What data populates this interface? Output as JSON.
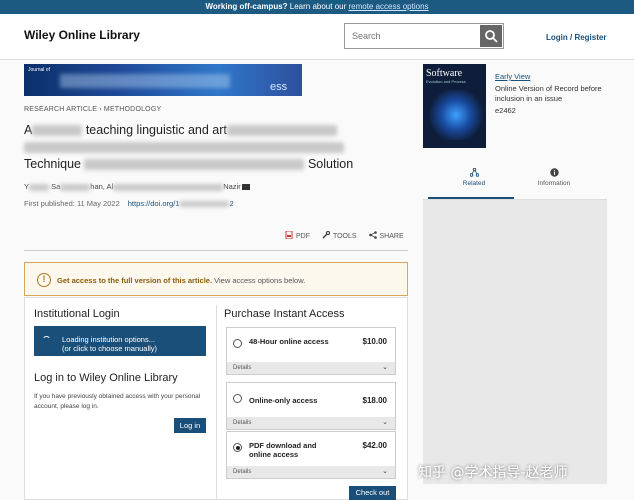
{
  "topbar": {
    "bold": "Working off-campus?",
    "text": " Learn about our ",
    "link": "remote access options"
  },
  "header": {
    "logo": "Wiley Online Library",
    "search_placeholder": "Search",
    "login": "Login / Register"
  },
  "journal": {
    "banner_small": "Journal of",
    "banner_visible": "ess"
  },
  "article": {
    "kind": "RESEARCH ARTICLE › METHODOLOGY",
    "title_line1_start": "A",
    "title_line1_mid": " teaching linguistic and art",
    "title_line3_start": "Technique",
    "title_line3_end": "Solution",
    "authors_start": "Y",
    "authors_mid1": " Sa",
    "authors_mid2": "han, Al",
    "authors_end": "Nazir",
    "published_label": "First published: 11 May 2022",
    "doi": "https://doi.org/1",
    "doi_end": "2"
  },
  "tools": {
    "pdf": "PDF",
    "tools": "TOOLS",
    "share": "SHARE"
  },
  "notice": {
    "bold": "Get access to the full version of this article.",
    "text": " View access options below."
  },
  "institutional": {
    "title": "Institutional Login",
    "button_line1": "Loading institution options...",
    "button_line2": "(or click to choose manually)"
  },
  "wol": {
    "title": "Log in to Wiley Online Library",
    "text": "If you have previously obtained access with your personal account, please log in.",
    "button": "Log in"
  },
  "purchase": {
    "title": "Purchase Instant Access",
    "options": [
      {
        "label": "48-Hour online access",
        "price": "$10.00",
        "details": "Details",
        "selected": false
      },
      {
        "label": "Online-only access",
        "price": "$18.00",
        "details": "Details",
        "selected": false
      },
      {
        "label": "PDF download and online access",
        "price": "$42.00",
        "details": "Details",
        "selected": true
      }
    ],
    "checkout": "Check out"
  },
  "sidebar": {
    "cover_title": "Software",
    "cover_sub": "Evolution and Process",
    "early_view": "Early View",
    "early_desc": "Online Version of Record before inclusion in an issue",
    "article_id": "e2462",
    "tabs": [
      {
        "label": "Related"
      },
      {
        "label": "Information"
      }
    ]
  },
  "watermark": "知乎 @学术指导-赵老师",
  "colors": {
    "brand": "#1a4f7a",
    "topbar": "#1c5a82",
    "notice_border": "#d8a657"
  }
}
